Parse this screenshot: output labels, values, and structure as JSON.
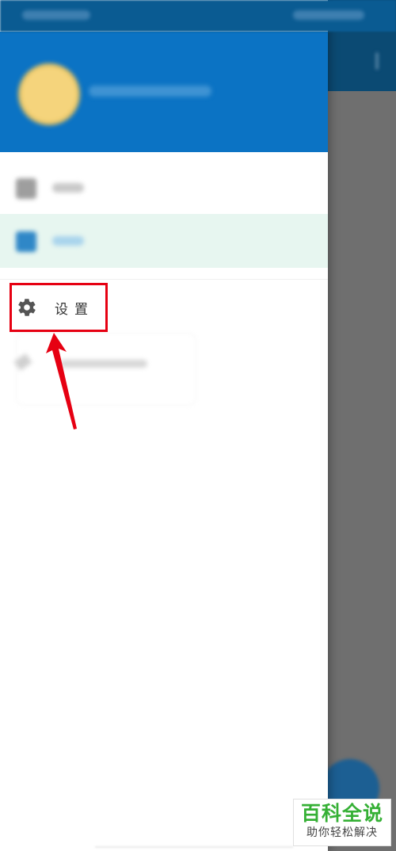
{
  "drawer": {
    "settings_label": "设置"
  },
  "icons": {
    "settings": "gear-icon",
    "annotation": "arrow-up-icon"
  },
  "watermark": {
    "title": "百科全说",
    "subtitle": "助你轻松解决"
  },
  "colors": {
    "header_blue": "#0b73c4",
    "status_bar_blue": "#0a5b92",
    "selected_item_bg": "#e7f6f0",
    "annotation_red": "#e60012",
    "watermark_green": "#35b035"
  }
}
